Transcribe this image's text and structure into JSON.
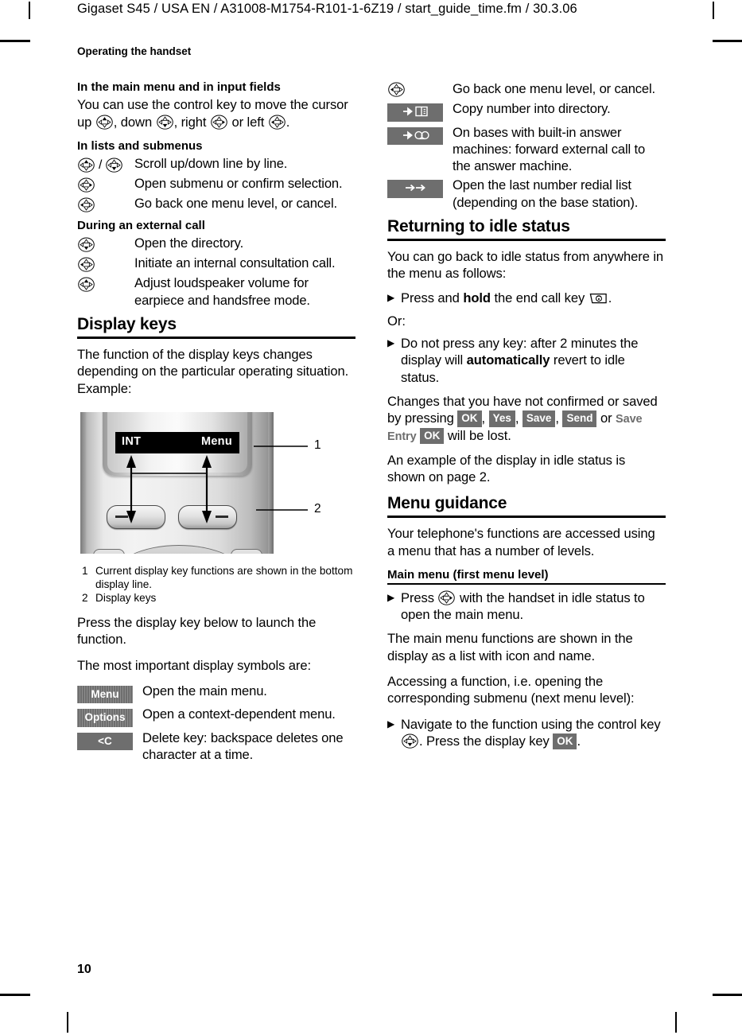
{
  "document": {
    "running_header": "Gigaset S45 / USA EN / A31008-M1754-R101-1-6Z19 / start_guide_time.fm / 30.3.06",
    "page_heading": "Operating the handset",
    "folio": "10"
  },
  "left_column": {
    "sub_main_menu": {
      "heading": "In the main menu and in input fields",
      "body_1": "You can use the control key to move the",
      "body_2": "cursor up",
      "body_3": ", down",
      "body_4": ", right",
      "body_5": "or left",
      "body_6": "."
    },
    "sub_lists": {
      "heading": "In lists and submenus",
      "rows": [
        {
          "key_icon_1": "control-key-up",
          "separator": "/",
          "key_icon_2": "control-key-down",
          "text": "Scroll up/down line by line."
        },
        {
          "key_icon_1": "control-key-right",
          "text": "Open submenu or confirm selection."
        },
        {
          "key_icon_1": "control-key-left",
          "text": "Go back one menu level, or cancel."
        }
      ]
    },
    "sub_external_call": {
      "heading": "During an external call",
      "rows": [
        {
          "key_icon_1": "control-key-down",
          "text": "Open the directory."
        },
        {
          "key_icon_1": "control-key-left",
          "text": "Initiate an internal consultation call."
        },
        {
          "key_icon_1": "control-key-up",
          "text": "Adjust loudspeaker volume for earpiece and handsfree mode."
        }
      ]
    },
    "display_keys": {
      "heading": "Display keys",
      "intro": "The function of the display keys changes depending on the particular operating situation. Example:",
      "figure": {
        "lcd_left_label": "INT",
        "lcd_right_label": "Menu",
        "callout_1": "1",
        "callout_2": "2"
      },
      "caption": [
        {
          "num": "1",
          "text": "Current display key functions are shown in the bottom display line."
        },
        {
          "num": "2",
          "text": "Display keys"
        }
      ],
      "after_1": "Press the display key below to launch the function.",
      "after_2": "The most important display symbols are:",
      "symbols": [
        {
          "badge": "Menu",
          "style": "striped",
          "text": "Open the main menu."
        },
        {
          "badge": "Options",
          "style": "striped",
          "text": "Open a context-dependent menu."
        },
        {
          "badge": "<C",
          "style": "plain",
          "text": "Delete key: backspace deletes one character at a time."
        }
      ]
    }
  },
  "right_column": {
    "continued_rows": [
      {
        "key_icon_1": "control-key-left",
        "text": "Go back one menu level, or cancel."
      }
    ],
    "symbol_rows": [
      {
        "badge_icon": "arrow-to-directory-icon",
        "text": "Copy number into directory."
      },
      {
        "badge_icon": "arrow-to-answer-machine-icon",
        "text": "On bases with built-in answer machines: forward external call to the answer machine."
      },
      {
        "badge_icon": "double-arrow-redial-icon",
        "text": "Open the last number redial list (depending on the base station)."
      }
    ],
    "returning": {
      "heading": "Returning to idle status",
      "intro": "You can go back to idle status from anywhere in the menu as follows:",
      "bullet_1_a": "Press and",
      "bullet_1_b": "hold",
      "bullet_1_c": "the end call key",
      "bullet_1_d": ".",
      "or_label": "Or:",
      "bullet_2_a": "Do not press any key: after 2 minutes the display will",
      "bullet_2_b": "automatically",
      "bullet_2_c": "revert to idle status.",
      "changes_a": "Changes that you have not confirmed or saved by pressing",
      "changes_badges": [
        "OK",
        "Yes",
        "Save",
        "Send"
      ],
      "changes_b": "or",
      "changes_grey": "Save Entry",
      "changes_badge_last": "OK",
      "changes_c": "will be lost.",
      "example": "An example of the display in idle status is shown on page 2."
    },
    "menu_guidance": {
      "heading": "Menu guidance",
      "intro": "Your telephone's functions are accessed using a menu that has a number of levels.",
      "main_menu_heading": "Main menu (first menu level)",
      "bullet_a": "Press",
      "bullet_b": "with the handset in idle status to open the main menu.",
      "para_1": "The main menu functions are shown in the display as a list with icon and name.",
      "para_2": "Accessing a function, i.e. opening the corresponding submenu (next menu level):",
      "bullet_2_a": "Navigate to the function using the control key",
      "bullet_2_b": ". Press the display key",
      "bullet_2_badge": "OK",
      "bullet_2_c": "."
    }
  },
  "colors": {
    "badge_grey": "#6e6e6e",
    "badge_dark": "#6a6a6a",
    "text": "#000000",
    "grey_text": "#6e6e6e"
  }
}
